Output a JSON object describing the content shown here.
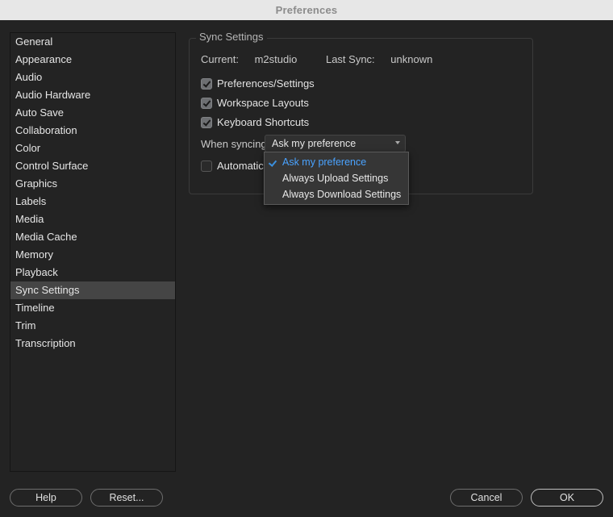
{
  "window": {
    "title": "Preferences"
  },
  "sidebar": {
    "items": [
      {
        "label": "General"
      },
      {
        "label": "Appearance"
      },
      {
        "label": "Audio"
      },
      {
        "label": "Audio Hardware"
      },
      {
        "label": "Auto Save"
      },
      {
        "label": "Collaboration"
      },
      {
        "label": "Color"
      },
      {
        "label": "Control Surface"
      },
      {
        "label": "Graphics"
      },
      {
        "label": "Labels"
      },
      {
        "label": "Media"
      },
      {
        "label": "Media Cache"
      },
      {
        "label": "Memory"
      },
      {
        "label": "Playback"
      },
      {
        "label": "Sync Settings"
      },
      {
        "label": "Timeline"
      },
      {
        "label": "Trim"
      },
      {
        "label": "Transcription"
      }
    ],
    "selected_index": 14
  },
  "panel": {
    "legend": "Sync Settings",
    "current_label": "Current:",
    "current_value": "m2studio",
    "last_sync_label": "Last Sync:",
    "last_sync_value": "unknown",
    "prefs_settings_label": "Preferences/Settings",
    "workspace_layouts_label": "Workspace Layouts",
    "keyboard_shortcuts_label": "Keyboard Shortcuts",
    "auto_clear_label": "Automaticall",
    "prefs_settings_checked": true,
    "workspace_layouts_checked": true,
    "keyboard_shortcuts_checked": true,
    "auto_clear_checked": false,
    "when_syncing_label": "When syncing:",
    "when_syncing_value": "Ask my preference",
    "when_syncing_options": [
      "Ask my preference",
      "Always Upload Settings",
      "Always Download Settings"
    ],
    "when_syncing_selected_index": 0,
    "when_syncing_open": true
  },
  "buttons": {
    "help": "Help",
    "reset": "Reset...",
    "cancel": "Cancel",
    "ok": "OK"
  }
}
